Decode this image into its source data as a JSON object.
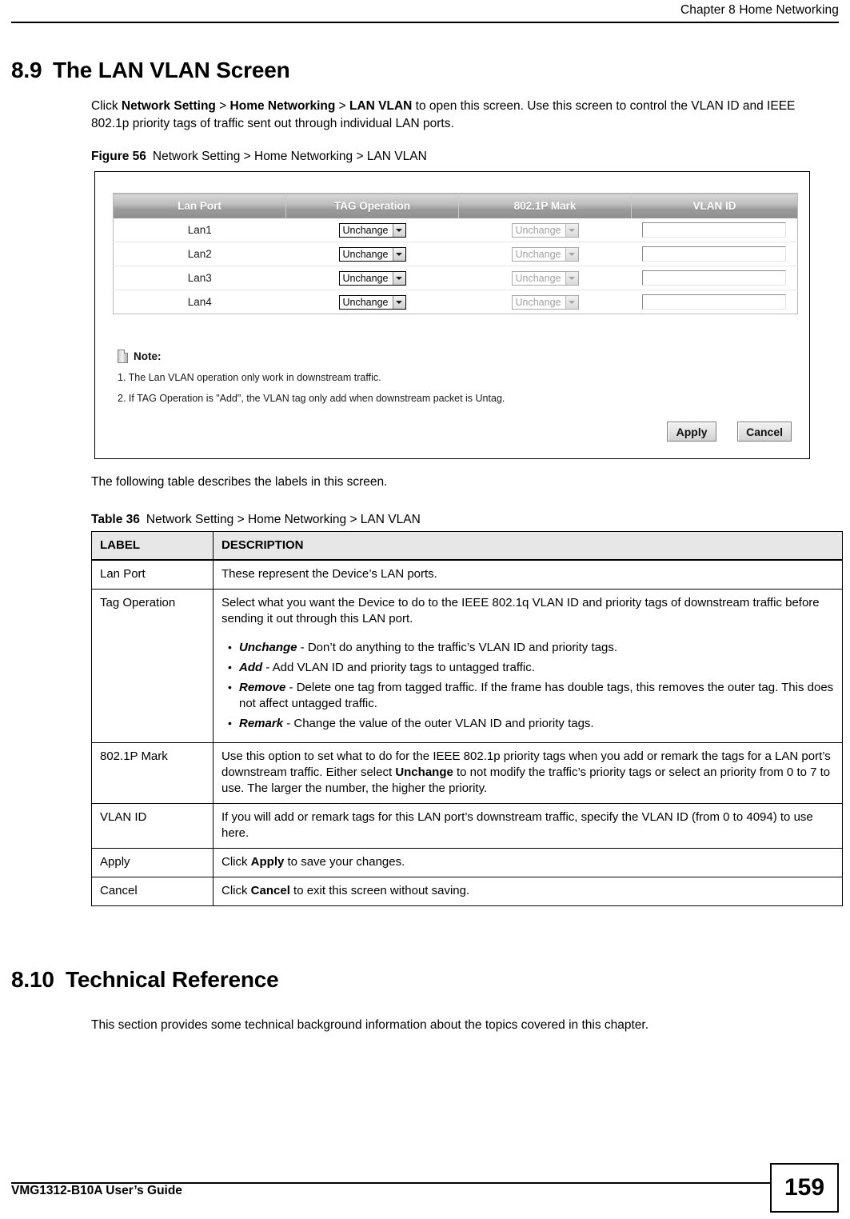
{
  "page_header": {
    "chapter_title": "Chapter 8 Home Networking"
  },
  "section": {
    "number": "8.9",
    "title": "The LAN VLAN Screen",
    "intro_parts": {
      "p1": "Click ",
      "b1": "Network Setting",
      "p2": " > ",
      "b2": "Home Networking",
      "p3": " > ",
      "b3": "LAN VLAN",
      "p4": " to open this screen. Use this screen to control the VLAN ID and IEEE 802.1p priority tags of traffic sent out through individual LAN ports."
    }
  },
  "figure": {
    "label": "Figure 56",
    "caption": "Network Setting > Home Networking > LAN VLAN",
    "screen": {
      "columns": [
        "Lan Port",
        "TAG Operation",
        "802.1P Mark",
        "VLAN ID"
      ],
      "rows": [
        {
          "lan_port": "Lan1",
          "tag_operation": "Unchange",
          "mark_802_1p": "Unchange",
          "vlan_id": ""
        },
        {
          "lan_port": "Lan2",
          "tag_operation": "Unchange",
          "mark_802_1p": "Unchange",
          "vlan_id": ""
        },
        {
          "lan_port": "Lan3",
          "tag_operation": "Unchange",
          "mark_802_1p": "Unchange",
          "vlan_id": ""
        },
        {
          "lan_port": "Lan4",
          "tag_operation": "Unchange",
          "mark_802_1p": "Unchange",
          "vlan_id": ""
        }
      ],
      "note": {
        "icon": "note-document-icon",
        "title": "Note:",
        "lines": [
          "1. The Lan VLAN operation only work in downstream traffic.",
          "2. If TAG Operation is \"Add\", the VLAN tag only add when downstream packet is Untag."
        ]
      },
      "buttons": {
        "apply": "Apply",
        "cancel": "Cancel"
      }
    }
  },
  "intro_table_text": "The following table describes the labels in this screen.",
  "table": {
    "label": "Table 36",
    "caption": "Network Setting > Home Networking > LAN VLAN",
    "headers": [
      "LABEL",
      "DESCRIPTION"
    ],
    "rows": [
      {
        "label": "Lan Port",
        "description": "These represent the Device’s LAN ports."
      },
      {
        "label": "Tag Operation",
        "description": "Select what you want the Device to do to the IEEE 802.1q VLAN ID and priority tags of downstream traffic before sending it out through this LAN port.",
        "options": [
          {
            "term": "Unchange",
            "text": " - Don’t do anything to the traffic’s VLAN ID and priority tags."
          },
          {
            "term": "Add",
            "text": " - Add VLAN ID and priority tags to untagged traffic."
          },
          {
            "term": "Remove",
            "text": " - Delete one tag from tagged traffic. If the frame has double tags, this removes the outer tag. This does not affect untagged traffic."
          },
          {
            "term": "Remark",
            "text": " - Change the value of the outer VLAN ID and priority tags."
          }
        ]
      },
      {
        "label": "802.1P Mark",
        "desc_part1": "Use this option to set what to do for the IEEE 802.1p priority tags when you add or remark the tags for a LAN port’s downstream traffic. Either select ",
        "desc_bold": "Unchange",
        "desc_part2": " to not modify the traffic’s priority tags or select an priority from 0 to 7 to use. The larger the number, the higher the priority."
      },
      {
        "label": "VLAN ID",
        "description": "If you will add or remark tags for this LAN port’s downstream traffic, specify the VLAN ID (from 0 to 4094) to use here."
      },
      {
        "label": "Apply",
        "desc_part1": "Click ",
        "desc_bold": "Apply",
        "desc_part2": " to save your changes."
      },
      {
        "label": "Cancel",
        "desc_part1": "Click ",
        "desc_bold": "Cancel",
        "desc_part2": " to exit this screen without saving."
      }
    ]
  },
  "section2": {
    "number": "8.10",
    "title": "Technical Reference",
    "body": "This section provides some technical background information about the topics covered in this chapter."
  },
  "footer": {
    "guide": "VMG1312-B10A User’s Guide",
    "page_number": "159"
  }
}
